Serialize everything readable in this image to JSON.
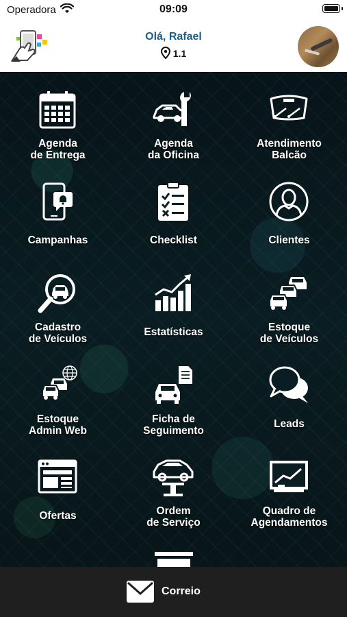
{
  "status_bar": {
    "carrier": "Operadora",
    "time": "09:09"
  },
  "header": {
    "greeting": "Olá, Rafael",
    "location": "1.1"
  },
  "menu": [
    {
      "label": "Agenda\nde Entrega",
      "icon": "calendar-icon"
    },
    {
      "label": "Agenda\nda Oficina",
      "icon": "car-wrench-icon"
    },
    {
      "label": "Atendimento\nBalcão",
      "icon": "windshield-icon"
    },
    {
      "label": "Campanhas",
      "icon": "phone-notification-icon"
    },
    {
      "label": "Checklist",
      "icon": "checklist-icon"
    },
    {
      "label": "Clientes",
      "icon": "person-icon"
    },
    {
      "label": "Cadastro\nde Veículos",
      "icon": "car-search-icon"
    },
    {
      "label": "Estatísticas",
      "icon": "bar-chart-icon"
    },
    {
      "label": "Estoque\nde Veículos",
      "icon": "car-stack-icon"
    },
    {
      "label": "Estoque\nAdmin Web",
      "icon": "car-stack-globe-icon"
    },
    {
      "label": "Ficha de\nSeguimento",
      "icon": "car-document-icon"
    },
    {
      "label": "Leads",
      "icon": "chat-bubbles-icon"
    },
    {
      "label": "Ofertas",
      "icon": "browser-window-icon"
    },
    {
      "label": "Ordem\nde Serviço",
      "icon": "car-lift-icon"
    },
    {
      "label": "Quadro de\nAgendamentos",
      "icon": "whiteboard-chart-icon"
    }
  ],
  "footer": {
    "mail_label": "Correio",
    "mail_icon": "envelope-icon"
  },
  "colors": {
    "greeting": "#1a5e8a",
    "background": "#0a1d22",
    "footer": "#1f1f1f"
  }
}
